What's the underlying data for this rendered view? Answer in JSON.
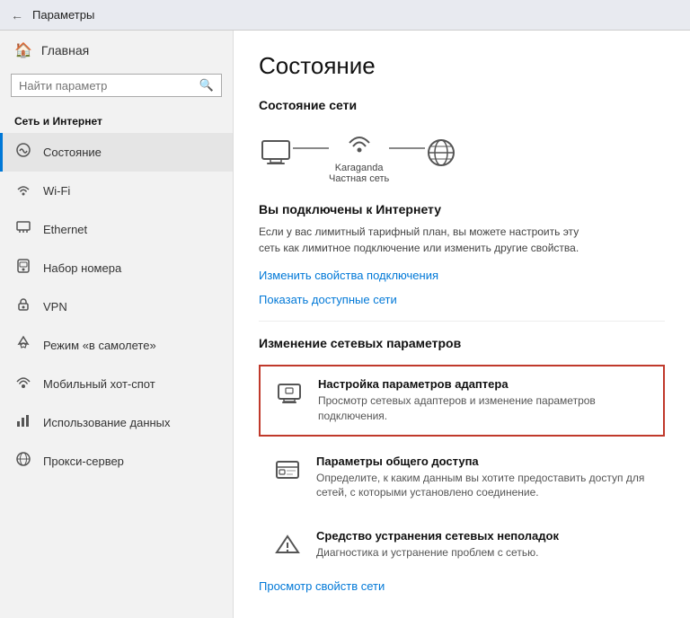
{
  "titleBar": {
    "back": "←",
    "title": "Параметры"
  },
  "sidebar": {
    "homeLabel": "Главная",
    "searchPlaceholder": "Найти параметр",
    "sectionTitle": "Сеть и Интернет",
    "items": [
      {
        "id": "status",
        "label": "Состояние",
        "icon": "🌐",
        "active": true
      },
      {
        "id": "wifi",
        "label": "Wi-Fi",
        "icon": "📶"
      },
      {
        "id": "ethernet",
        "label": "Ethernet",
        "icon": "🖥"
      },
      {
        "id": "dialup",
        "label": "Набор номера",
        "icon": "📞"
      },
      {
        "id": "vpn",
        "label": "VPN",
        "icon": "🔒"
      },
      {
        "id": "airplane",
        "label": "Режим «в самолете»",
        "icon": "✈"
      },
      {
        "id": "hotspot",
        "label": "Мобильный хот-спот",
        "icon": "📡"
      },
      {
        "id": "datausage",
        "label": "Использование данных",
        "icon": "📊"
      },
      {
        "id": "proxy",
        "label": "Прокси-сервер",
        "icon": "🌍"
      }
    ]
  },
  "content": {
    "pageTitle": "Состояние",
    "networkSectionTitle": "Состояние сети",
    "networkLabel": "Karaganda",
    "networkSubLabel": "Частная сеть",
    "connectedTitle": "Вы подключены к Интернету",
    "connectedDesc": "Если у вас лимитный тарифный план, вы можете настроить эту сеть как лимитное подключение или изменить другие свойства.",
    "link1": "Изменить свойства подключения",
    "link2": "Показать доступные сети",
    "changeSettingsTitle": "Изменение сетевых параметров",
    "settingsItems": [
      {
        "id": "adapter",
        "name": "Настройка параметров адаптера",
        "desc": "Просмотр сетевых адаптеров и изменение параметров подключения.",
        "highlighted": true
      },
      {
        "id": "sharing",
        "name": "Параметры общего доступа",
        "desc": "Определите, к каким данным вы хотите предоставить доступ для сетей, с которыми установлено соединение.",
        "highlighted": false
      },
      {
        "id": "troubleshoot",
        "name": "Средство устранения сетевых неполадок",
        "desc": "Диагностика и устранение проблем с сетью.",
        "highlighted": false
      }
    ],
    "bottomLink": "Просмотр свойств сети"
  }
}
